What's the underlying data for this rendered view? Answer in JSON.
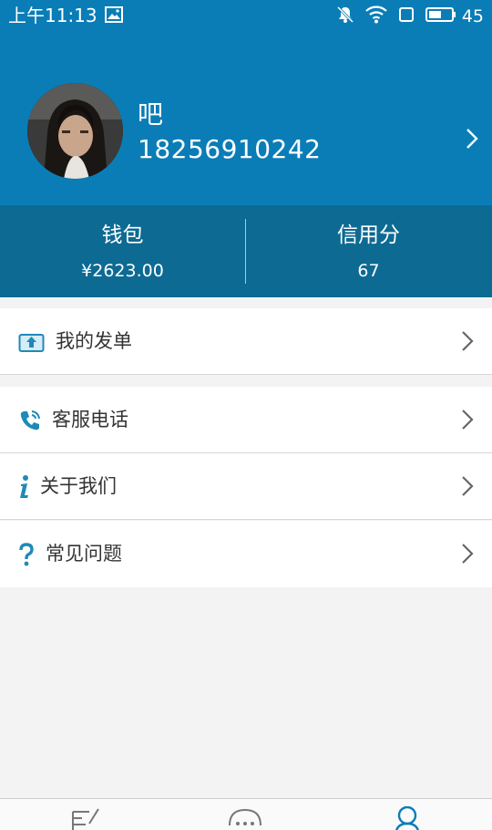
{
  "status_bar": {
    "time": "上午11:13",
    "battery": "45"
  },
  "profile": {
    "name": "吧",
    "phone": "18256910242"
  },
  "stats": {
    "wallet_label": "钱包",
    "wallet_value": "¥2623.00",
    "credit_label": "信用分",
    "credit_value": "67"
  },
  "menu": [
    {
      "label": "我的发单",
      "icon": "upload-icon"
    },
    {
      "label": "客服电话",
      "icon": "phone-icon"
    },
    {
      "label": "关于我们",
      "icon": "info-icon"
    },
    {
      "label": "常见问题",
      "icon": "question-icon"
    }
  ],
  "tabbar": [
    {
      "icon": "edit-icon",
      "active": false
    },
    {
      "icon": "chat-icon",
      "active": false
    },
    {
      "icon": "user-icon",
      "active": true
    }
  ],
  "colors": {
    "primary": "#0a7db7",
    "stats_bg": "#0d6a93",
    "icon_accent": "#1e8ab8",
    "background": "#f3f3f3"
  }
}
